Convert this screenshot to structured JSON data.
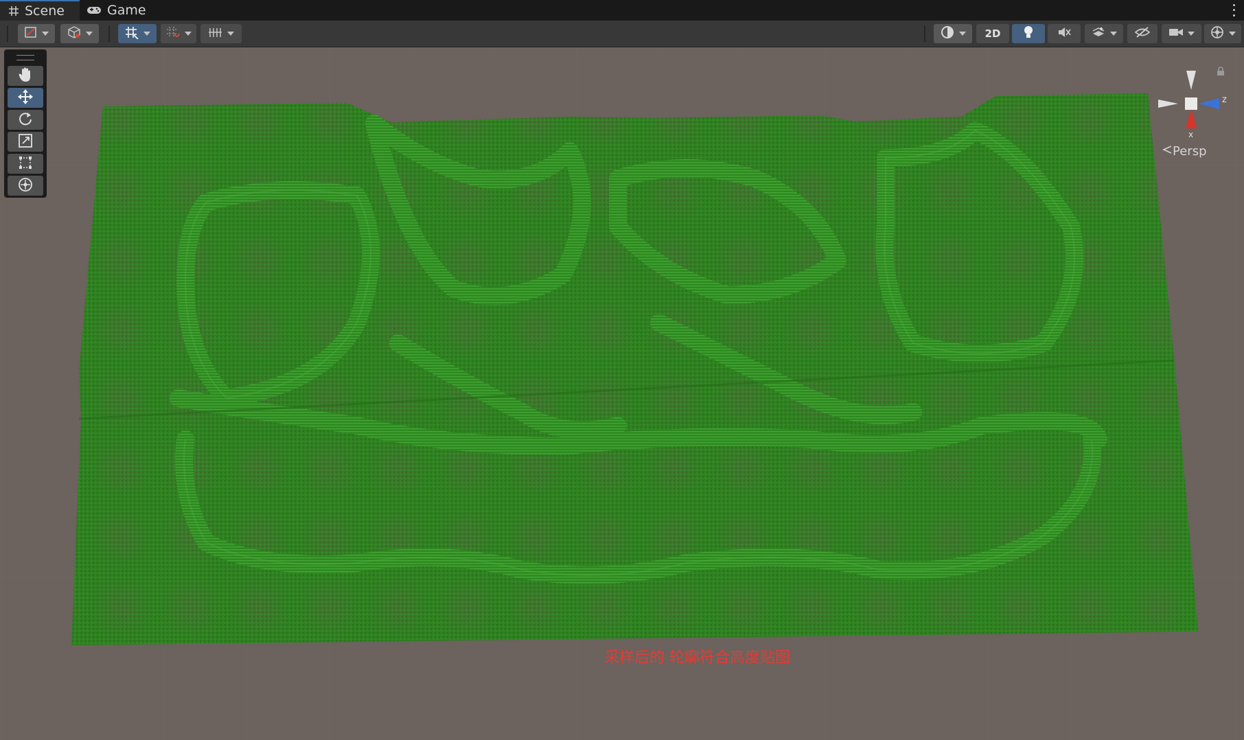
{
  "tabs": [
    {
      "label": "Scene",
      "icon": "grid-hash-icon",
      "active": true
    },
    {
      "label": "Game",
      "icon": "gamepad-icon",
      "active": false
    }
  ],
  "toolbar": {
    "left_tools": [
      "draw-mode-icon",
      "cube-icon",
      "grid-snap-icon",
      "increment-snap-icon",
      "ruler-grid-icon"
    ],
    "right_tools": [
      "shading-mode-icon",
      "2d-toggle",
      "lighting-icon",
      "audio-mute-icon",
      "effects-icon",
      "hidden-objects-icon",
      "camera-icon",
      "gizmos-icon"
    ],
    "toggle_2d_label": "2D",
    "active_color": "#46607f"
  },
  "tool_palette": {
    "tools": [
      "hand-tool",
      "move-tool",
      "rotate-tool",
      "scale-tool",
      "rect-tool",
      "transform-tool"
    ],
    "active": "move-tool"
  },
  "gizmo": {
    "view_label": "Persp",
    "axis_x_label": "x",
    "axis_z_label": "z",
    "x_color": "#d8352a",
    "z_color": "#3b73d6",
    "y_color": "#e0e0e0"
  },
  "scene": {
    "terrain_color": "#2e7d1e",
    "background_color": "#6c625e",
    "caption": "采样后的 轮廓符合高度贴图",
    "caption_color": "#e63b33"
  }
}
